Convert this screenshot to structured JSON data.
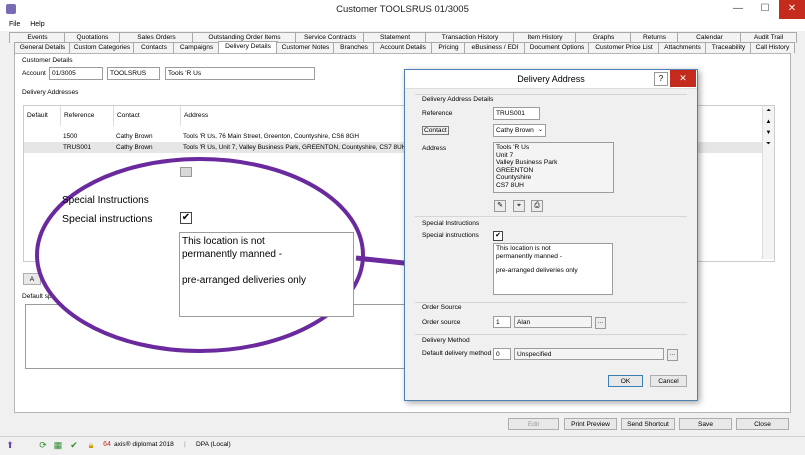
{
  "window": {
    "title": "Customer TOOLSRUS 01/3005",
    "minimize": "—",
    "maximize": "☐",
    "close": "✕"
  },
  "menu": [
    "File",
    "Help"
  ],
  "tabs_row1": [
    "Events",
    "Quotations",
    "Sales Orders",
    "Outstanding Order Items",
    "Service Contracts",
    "Statement",
    "Transaction History",
    "Item History",
    "Graphs",
    "Returns",
    "Calendar",
    "Audit Trail"
  ],
  "tabs_row2": [
    "General Details",
    "Custom Categories",
    "Contacts",
    "Campaigns",
    "Delivery Details",
    "Customer Notes",
    "Branches",
    "Account Details",
    "Pricing",
    "eBusiness / EDI",
    "Document Options",
    "Customer Price List",
    "Attachments",
    "Traceability",
    "Call History"
  ],
  "active_tab": "Delivery Details",
  "customer": {
    "group_label": "Customer Details",
    "account_label": "Account",
    "account": "01/3005",
    "code": "TOOLSRUS",
    "name": "Tools 'R Us"
  },
  "delivery": {
    "group_label": "Delivery Addresses",
    "columns": [
      "Default",
      "Reference",
      "Contact",
      "Address"
    ],
    "rows": [
      {
        "default": "",
        "reference": "1500",
        "contact": "Cathy Brown",
        "address": "Tools 'R Us, 76 Main Street, Greenton, Countyshire, CS6 8GH"
      },
      {
        "default": "",
        "reference": "TRUS001",
        "contact": "Cathy Brown",
        "address": "Tools 'R Us, Unit 7, Valley Business Park, GREENTON, Countyshire, CS7 8UH"
      }
    ],
    "add_label": "A",
    "default_special_label": "Default speci"
  },
  "zoom": {
    "group_label": "Special Instructions",
    "check_label": "Special instructions",
    "checked": "✔",
    "text_line1": "This location is not",
    "text_line2": "permanently manned -",
    "text_line3": "pre-arranged deliveries only"
  },
  "dialog": {
    "title": "Delivery Address",
    "help": "?",
    "close": "✕",
    "details_label": "Delivery Address Details",
    "reference_label": "Reference",
    "reference": "TRUS001",
    "contact_label": "Contact",
    "contact": "Cathy Brown",
    "address_label": "Address",
    "address_lines": [
      "Tools 'R Us",
      "Unit 7",
      "Valley Business Park",
      "GREENTON",
      "Countyshire",
      "CS7 8UH"
    ],
    "special_group": "Special Instructions",
    "special_label": "Special instructions",
    "special_checked": "✔",
    "special_text1": "This location is not",
    "special_text2": "permanently manned -",
    "special_text3": "pre-arranged deliveries only",
    "order_source_group": "Order Source",
    "order_source_label": "Order source",
    "order_source_num": "1",
    "order_source_name": "Alan",
    "delivery_method_group": "Delivery Method",
    "delivery_method_label": "Default delivery method",
    "delivery_method_num": "0",
    "delivery_method_name": "Unspecified",
    "ok": "OK",
    "cancel": "Cancel"
  },
  "footer_buttons": {
    "edit": "Edit",
    "print_preview": "Print Preview",
    "send_shortcut": "Send Shortcut",
    "save": "Save",
    "close": "Close"
  },
  "status": {
    "app": "axis® diplomat 2018",
    "dpa": "DPA (Local)"
  },
  "colors": {
    "accent": "#3c7fb1",
    "callout": "#6a2a9e",
    "close_red": "#c42b1c"
  }
}
